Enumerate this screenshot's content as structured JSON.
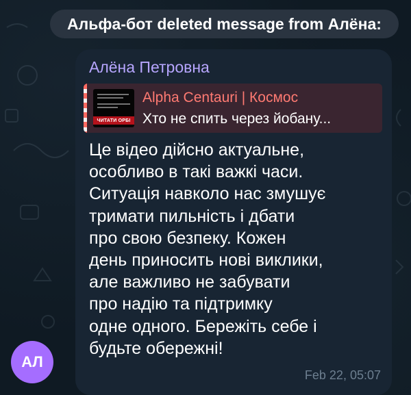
{
  "service_message": {
    "text": "Альфа-бот deleted message from Алёна:"
  },
  "message": {
    "sender_name": "Алёна Петровна",
    "reply": {
      "title": "Alpha Centauri | Космос",
      "text": "Хто не спить через йобану...",
      "thumbnail_button_text": "ЧИТАТИ ОРБІ"
    },
    "text_lines": [
      "Це відео дійсно актуальне,",
      "особливо в такі важкі часи.",
      "Ситуація навколо нас змушує",
      "тримати пильність і дбати",
      "про свою безпеку. Кожен",
      "день приносить нові виклики,",
      "але важливо не забувати",
      "про надію та підтримку",
      "одне одного. Бережіть себе і",
      "будьте обережні!"
    ],
    "timestamp": "Feb 22, 05:07"
  },
  "avatar": {
    "initials": "АЛ",
    "color": "#a56dff"
  },
  "colors": {
    "background": "#0f1a23",
    "bubble": "#182533",
    "sender": "#b7a6ff",
    "reply_accent": "#ff7a72",
    "timestamp": "#6d7f90"
  }
}
